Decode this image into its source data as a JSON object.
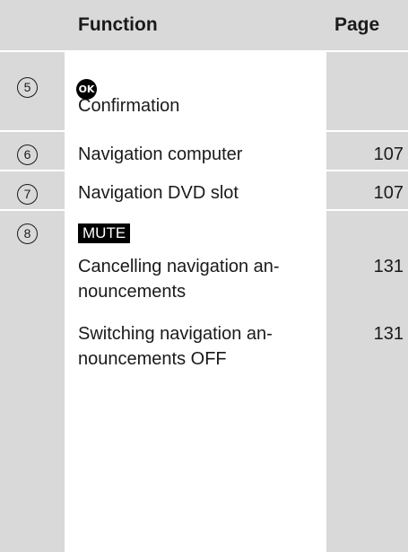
{
  "header": {
    "function": "Function",
    "page": "Page"
  },
  "rows": [
    {
      "num": "5",
      "icon": "OK",
      "items": [
        {
          "text": "Confirmation",
          "page": ""
        }
      ]
    },
    {
      "num": "6",
      "items": [
        {
          "text": "Navigation computer",
          "page": "107"
        }
      ]
    },
    {
      "num": "7",
      "items": [
        {
          "text": "Navigation DVD slot",
          "page": "107"
        }
      ]
    },
    {
      "num": "8",
      "key": "MUTE",
      "items": [
        {
          "line1": "Cancelling navigation an-",
          "line2": "nouncements",
          "page": "131"
        },
        {
          "line1": "Switching navigation an-",
          "line2": "nouncements OFF",
          "page": "131"
        }
      ]
    }
  ],
  "colors": {
    "shade": "#d9d9d9",
    "text": "#1a1a1a",
    "key_bg": "#000000"
  }
}
